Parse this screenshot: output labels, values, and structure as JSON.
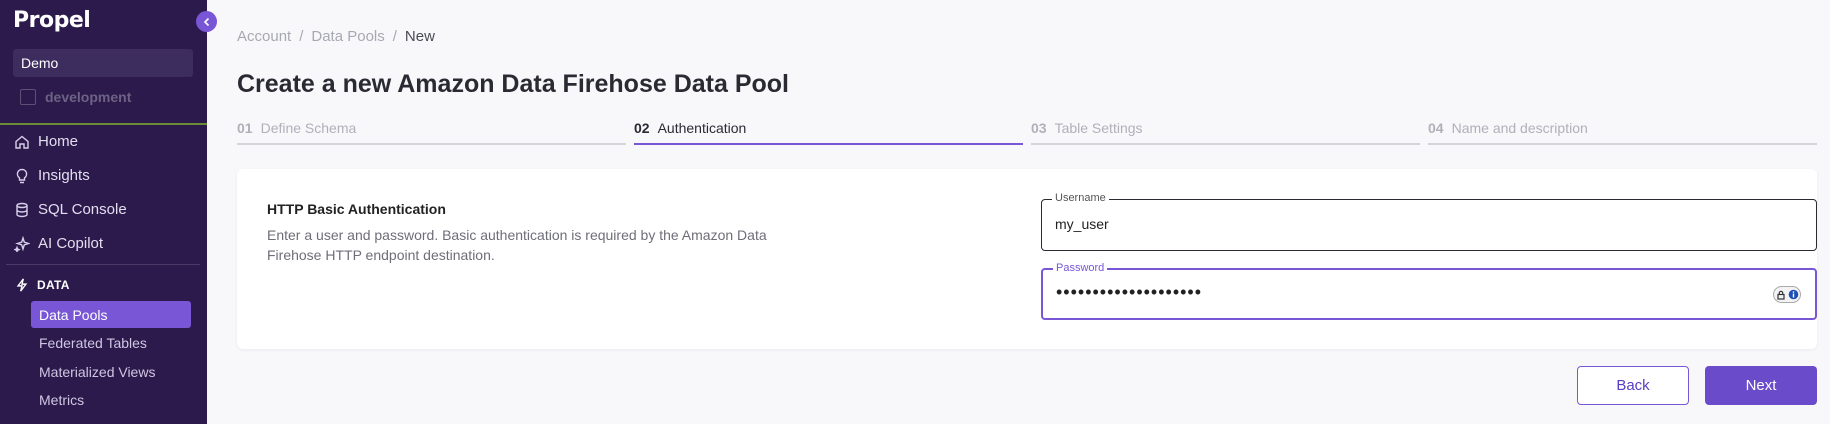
{
  "app": {
    "logo": "Propel"
  },
  "sidebar": {
    "environment": "Demo",
    "sub_environment": "development",
    "nav": [
      {
        "label": "Home",
        "icon": "home-icon"
      },
      {
        "label": "Insights",
        "icon": "lightbulb-icon"
      },
      {
        "label": "SQL Console",
        "icon": "database-icon"
      },
      {
        "label": "AI Copilot",
        "icon": "sparkle-icon"
      }
    ],
    "section": {
      "label": "DATA",
      "icon": "bolt-icon"
    },
    "data_items": [
      {
        "label": "Data Pools",
        "active": true
      },
      {
        "label": "Federated Tables",
        "active": false
      },
      {
        "label": "Materialized Views",
        "active": false
      },
      {
        "label": "Metrics",
        "active": false
      }
    ]
  },
  "breadcrumb": {
    "items": [
      "Account",
      "Data Pools",
      "New"
    ],
    "separator": "/"
  },
  "page": {
    "title": "Create a new Amazon Data Firehose Data Pool"
  },
  "steps": [
    {
      "num": "01",
      "label": "Define Schema",
      "active": false
    },
    {
      "num": "02",
      "label": "Authentication",
      "active": true
    },
    {
      "num": "03",
      "label": "Table Settings",
      "active": false
    },
    {
      "num": "04",
      "label": "Name and description",
      "active": false
    }
  ],
  "auth_card": {
    "title": "HTTP Basic Authentication",
    "description": "Enter a user and password. Basic authentication is required by the Amazon Data Firehose HTTP endpoint destination.",
    "username": {
      "label": "Username",
      "value": "my_user"
    },
    "password": {
      "label": "Password",
      "value": "••••••••••••••••••••"
    }
  },
  "actions": {
    "back_label": "Back",
    "next_label": "Next"
  },
  "colors": {
    "sidebar": "#2b1a4b",
    "accent": "#7856d6",
    "primary_button": "#6a4bc9"
  }
}
